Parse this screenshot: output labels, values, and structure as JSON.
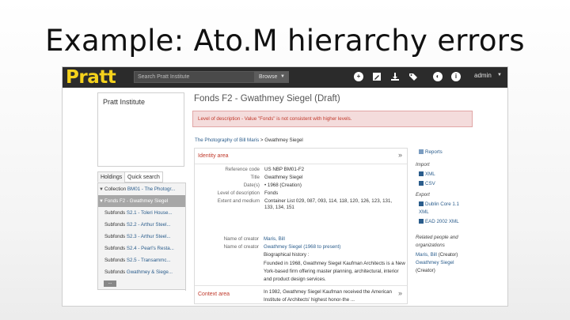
{
  "slide": {
    "title": "Example: Ato.M hierarchy errors"
  },
  "topbar": {
    "logo": "Pratt",
    "search_placeholder": "Search Pratt Institute",
    "browse_label": "Browse",
    "icons": [
      "plus-icon",
      "edit-icon",
      "download-icon",
      "tags-icon",
      "globe-icon",
      "info-icon"
    ],
    "user": "admin"
  },
  "sidebar": {
    "repository": "Pratt Institute",
    "tabs": [
      "Holdings",
      "Quick search"
    ],
    "tree": [
      {
        "level": "Collection",
        "label": "BM01 - The Photogr...",
        "toggle": "▼",
        "active": false
      },
      {
        "level": "Fonds",
        "label": "F2 - Gwathmey Siegel",
        "toggle": "▼",
        "active": true
      },
      {
        "level": "Subfonds",
        "label": "S2.1 - Toleri House...",
        "toggle": "",
        "active": false
      },
      {
        "level": "Subfonds",
        "label": "S2.2 - Arthur Steel...",
        "toggle": "",
        "active": false
      },
      {
        "level": "Subfonds",
        "label": "S2.3 - Arthur Steel...",
        "toggle": "",
        "active": false
      },
      {
        "level": "Subfonds",
        "label": "S2.4 - Pearl's Resta...",
        "toggle": "",
        "active": false
      },
      {
        "level": "Subfonds",
        "label": "S2.5 - Transammc...",
        "toggle": "",
        "active": false
      },
      {
        "level": "Subfonds",
        "label": "Gwathmey & Siege...",
        "toggle": "",
        "active": false
      }
    ],
    "more": "..."
  },
  "main": {
    "title": "Fonds F2 - Gwathmey Siegel (Draft)",
    "error": "Level of description - Value \"Fonds\" is not consistent with higher levels.",
    "breadcrumb": {
      "parent": "The Photography of Bill Maris",
      "separator": ">",
      "current": "Gwathmey Siegel"
    },
    "identity": {
      "heading": "Identity area",
      "fields": [
        {
          "label": "Reference code",
          "value": "US NBP BM01-F2"
        },
        {
          "label": "Title",
          "value": "Gwathmey Siegel"
        },
        {
          "label": "Date(s)",
          "value": "• 1968 (Creation)"
        },
        {
          "label": "Level of description",
          "value": "Fonds"
        },
        {
          "label": "Extent and medium",
          "value": "Container List 029, 087, 093, 114, 118, 120, 126, 123, 131, 133, 134, 151"
        }
      ]
    },
    "context": {
      "heading": "Context area",
      "fields": [
        {
          "label": "Name of creator",
          "value": "Maris, Bill"
        },
        {
          "label": "Name of creator",
          "value": "Gwathmey Siegel (1968 to present)"
        }
      ],
      "biography_heading": "Biographical history :",
      "biography_p1": "Founded in 1968, Gwathmey Siegel Kaufman Architects is a New York-based firm offering master planning, architectural, interior and product design services.",
      "biography_p2": "In 1982, Gwathmey Siegel Kaufman received the American Institute of Architects' highest honor-the ..."
    },
    "expand_arrow": "»"
  },
  "right": {
    "reports": "Reports",
    "import_heading": "Import",
    "import_xml": "XML",
    "import_csv": "CSV",
    "export_heading": "Export",
    "export_dc": "Dublin Core 1.1",
    "export_dc2": "XML",
    "export_ead": "EAD 2002 XML",
    "related_heading_1": "Related people and",
    "related_heading_2": "organizations",
    "related_1_name": "Maris, Bill",
    "related_1_role": "(Creator)",
    "related_2_name": "Gwathmey Siegel",
    "related_2_role": "(Creator)"
  },
  "colors": {
    "logo": "#f5d21c",
    "topbar": "#2b2b2b",
    "error_bg": "#f4dcdc",
    "error_text": "#c0392b",
    "link": "#2b5d8c"
  }
}
